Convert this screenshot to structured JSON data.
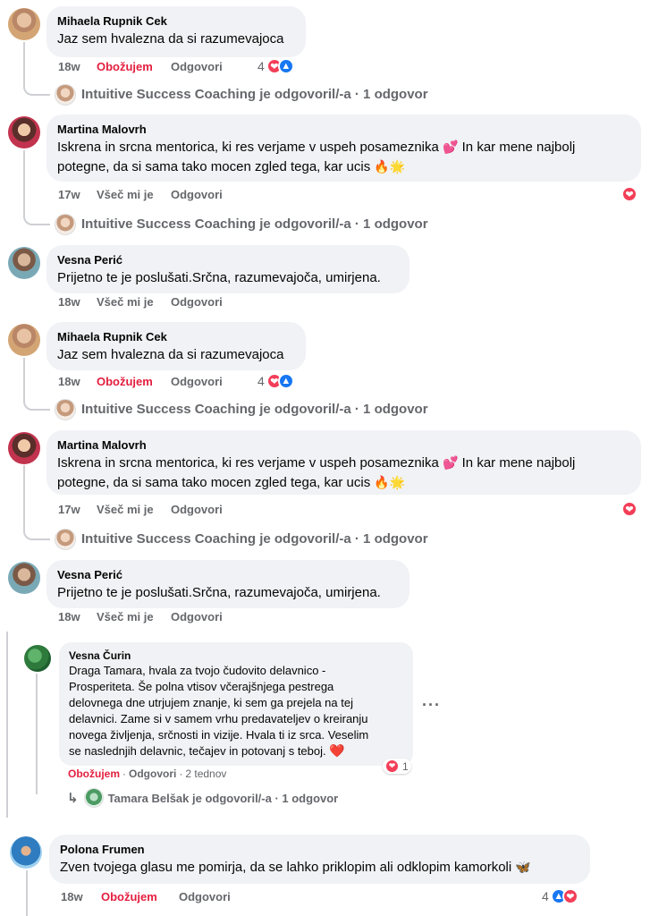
{
  "comments": [
    {
      "author": "Mihaela Rupnik Cek",
      "text": "Jaz sem hvalezna da si razumevajoca",
      "time": "18w",
      "reaction_label": "Obožujem",
      "reply_label": "Odgovori",
      "reaction_count": "4",
      "reply_summary": "Intuitive Success Coaching je odgovoril/-a · 1 odgovor"
    },
    {
      "author": "Martina Malovrh",
      "text_line1": "Iskrena in srcna mentorica, ki res verjame v uspeh posameznika",
      "text_line1_emoji": "💕",
      "text_line1_after": "In kar mene najbolj",
      "text_line2": "potegne, da si sama tako mocen zgled tega, kar ucis",
      "text_line2_emoji": "🔥🌟",
      "time": "17w",
      "reaction_label": "Všeč mi je",
      "reply_label": "Odgovori",
      "reply_summary": "Intuitive Success Coaching je odgovoril/-a · 1 odgovor"
    },
    {
      "author": "Vesna Perić",
      "text": "Prijetno te je poslušati.Srčna, razumevajoča, umirjena.",
      "time": "18w",
      "reaction_label": "Všeč mi je",
      "reply_label": "Odgovori"
    },
    {
      "author": "Mihaela Rupnik Cek",
      "text": "Jaz sem hvalezna da si razumevajoca",
      "time": "18w",
      "reaction_label": "Obožujem",
      "reply_label": "Odgovori",
      "reaction_count": "4",
      "reply_summary": "Intuitive Success Coaching je odgovoril/-a · 1 odgovor"
    },
    {
      "author": "Martina Malovrh",
      "text_line1": "Iskrena in srcna mentorica, ki res verjame v uspeh posameznika",
      "text_line1_emoji": "💕",
      "text_line1_after": "In kar mene najbolj",
      "text_line2": "potegne, da si sama tako mocen zgled tega, kar ucis",
      "text_line2_emoji": "🔥🌟",
      "time": "17w",
      "reaction_label": "Všeč mi je",
      "reply_label": "Odgovori",
      "reply_summary": "Intuitive Success Coaching je odgovoril/-a · 1 odgovor"
    },
    {
      "author": "Vesna Perić",
      "text": "Prijetno te je poslušati.Srčna, razumevajoča, umirjena.",
      "time": "18w",
      "reaction_label": "Všeč mi je",
      "reply_label": "Odgovori"
    },
    {
      "author": "Vesna Čurin",
      "lines": [
        "Draga Tamara, hvala za tvojo čudovito delavnico -",
        "Prosperiteta. Še polna vtisov včerajšnjega pestrega",
        "delovnega dne utrjujem znanje, ki sem ga prejela na tej",
        "delavnici. Zame si v samem vrhu predavateljev o kreiranju",
        "novega življenja, srčnosti in vizije. Hvala ti iz srca. Veselim",
        "se naslednjih delavnic, tečajev in potovanj s teboj."
      ],
      "heart": "❤️",
      "reaction_label": "Obožujem",
      "reply_label": "Odgovori",
      "time": "2 tednov",
      "reaction_count": "1",
      "more": "···",
      "reply_summary": "Tamara Belšak je odgovoril/-a · 1 odgovor"
    },
    {
      "author": "Polona Frumen",
      "text": "Zven tvojega glasu me pomirja, da se lahko priklopim ali odklopim kamorkoli",
      "emoji": "🦋",
      "time": "18w",
      "reaction_label": "Obožujem",
      "reply_label": "Odgovori",
      "reaction_count": "4"
    }
  ],
  "icons": {
    "love": "❤",
    "like": "👍",
    "reply_arrow": "↳"
  },
  "colors": {
    "bubble": "#f0f2f5",
    "love_red": "#e41e3f",
    "like_blue": "#1877f2",
    "meta_gray": "#65676b"
  }
}
